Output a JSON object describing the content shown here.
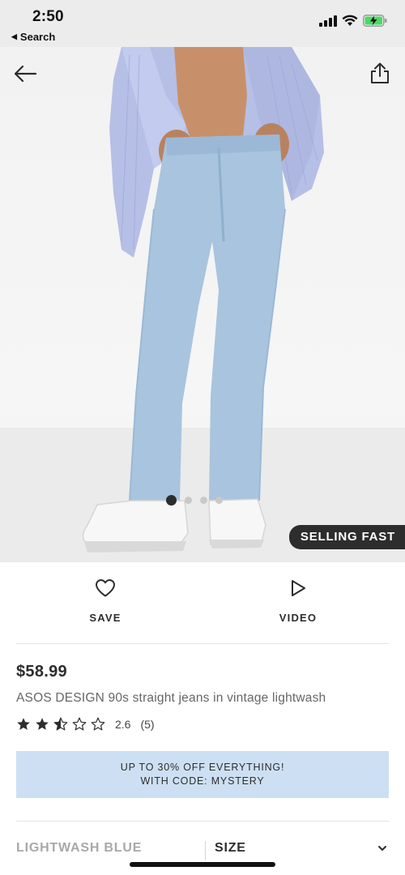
{
  "status_bar": {
    "time": "2:50",
    "back_label": "Search",
    "back_icon": "triangle-left",
    "icons": [
      "cellular-signal-icon",
      "wifi-icon",
      "battery-charging-icon"
    ],
    "battery_color": "#4cd964"
  },
  "hero": {
    "back_icon": "arrow-left-icon",
    "share_icon": "share-icon",
    "carousel": {
      "count": 4,
      "active": 1
    },
    "badge": "SELLING FAST"
  },
  "actions": {
    "save_label": "SAVE",
    "save_icon": "heart-icon",
    "video_label": "VIDEO",
    "video_icon": "play-icon"
  },
  "product": {
    "price": "$58.99",
    "title": "ASOS DESIGN 90s straight jeans in vintage lightwash",
    "rating": {
      "stars": 2.5,
      "max": 5,
      "score": "2.6",
      "count": "(5)"
    }
  },
  "promo": {
    "line1": "UP TO 30% OFF EVERYTHING!",
    "line2": "WITH CODE: MYSTERY",
    "background": "#cde0f3"
  },
  "selectors": {
    "colour": "LIGHTWASH BLUE",
    "size_label": "SIZE"
  }
}
